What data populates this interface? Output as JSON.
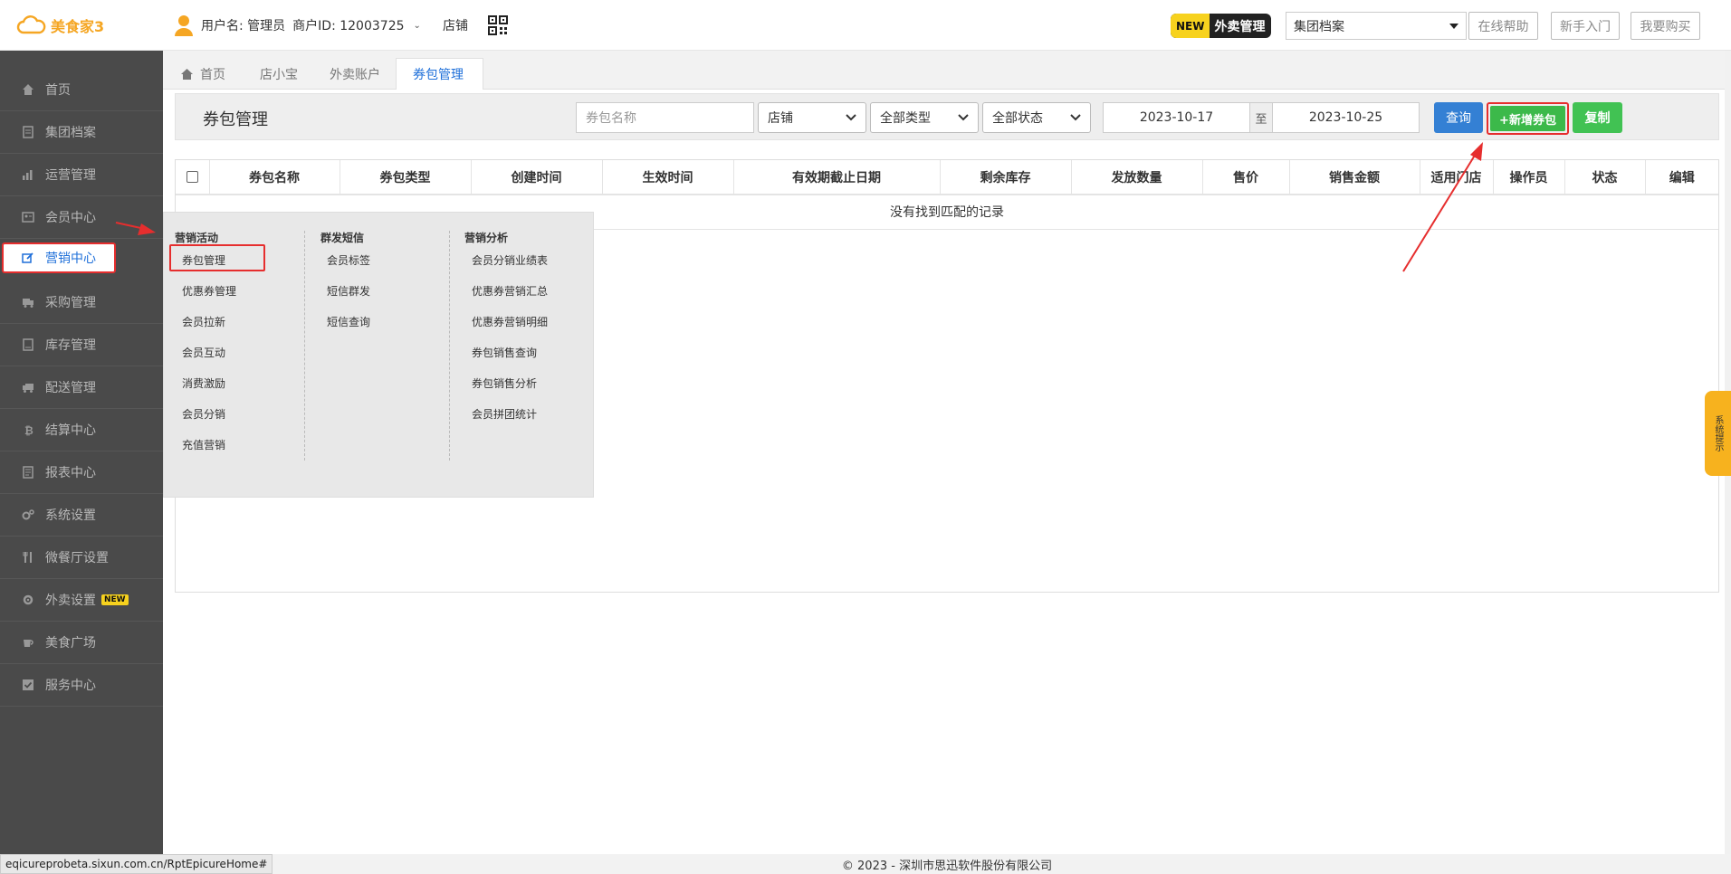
{
  "header": {
    "logo_text": "美食家3",
    "user_label": "用户名: 管理员",
    "merchant_label": "商户ID: 12003725",
    "store_link": "店铺",
    "new_badge_tag": "NEW",
    "new_badge_text": "外卖管理",
    "archive_select": "集团档案",
    "help_button": "在线帮助",
    "guide_button": "新手入门",
    "buy_button": "我要购买"
  },
  "sidebar": {
    "items": [
      {
        "label": "首页",
        "icon": "home-icon"
      },
      {
        "label": "集团档案",
        "icon": "document-icon"
      },
      {
        "label": "运营管理",
        "icon": "bar-chart-icon"
      },
      {
        "label": "会员中心",
        "icon": "member-card-icon"
      },
      {
        "label": "营销中心",
        "icon": "edit-icon",
        "active": true
      },
      {
        "label": "采购管理",
        "icon": "truck-icon"
      },
      {
        "label": "库存管理",
        "icon": "file-icon"
      },
      {
        "label": "配送管理",
        "icon": "delivery-truck-icon"
      },
      {
        "label": "结算中心",
        "icon": "bitcoin-icon"
      },
      {
        "label": "报表中心",
        "icon": "report-icon"
      },
      {
        "label": "系统设置",
        "icon": "gears-icon"
      },
      {
        "label": "微餐厅设置",
        "icon": "cutlery-icon"
      },
      {
        "label": "外卖设置",
        "icon": "gear-icon",
        "badge": "NEW"
      },
      {
        "label": "美食广场",
        "icon": "coffee-icon"
      },
      {
        "label": "服务中心",
        "icon": "check-square-icon"
      }
    ]
  },
  "tabs": [
    {
      "label": "首页"
    },
    {
      "label": "店小宝"
    },
    {
      "label": "外卖账户"
    },
    {
      "label": "券包管理",
      "active": true
    }
  ],
  "toolbar": {
    "title": "券包管理",
    "name_placeholder": "券包名称",
    "store_select": "店铺",
    "type_select": "全部类型",
    "status_select": "全部状态",
    "date_start": "2023-10-17",
    "date_sep": "至",
    "date_end": "2023-10-25",
    "query_button": "查询",
    "add_button": "+新增券包",
    "copy_button": "复制"
  },
  "table": {
    "columns": [
      "券包名称",
      "券包类型",
      "创建时间",
      "生效时间",
      "有效期截止日期",
      "剩余库存",
      "发放数量",
      "售价",
      "销售金额",
      "适用门店",
      "操作员",
      "状态",
      "编辑"
    ],
    "empty_text": "没有找到匹配的记录"
  },
  "mega_menu": {
    "col1": {
      "title": "营销活动",
      "items": [
        "券包管理",
        "优惠券管理",
        "会员拉新",
        "会员互动",
        "消费激励",
        "会员分销",
        "充值营销"
      ]
    },
    "col2": {
      "title": "群发短信",
      "items": [
        "会员标签",
        "短信群发",
        "短信查询"
      ]
    },
    "col3": {
      "title": "营销分析",
      "items": [
        "会员分销业绩表",
        "优惠券营销汇总",
        "优惠券营销明细",
        "券包销售查询",
        "券包销售分析",
        "会员拼团统计"
      ]
    }
  },
  "side_tab": "系统提示",
  "footer": "© 2023 - 深圳市思迅软件股份有限公司",
  "status_url": "eqicureprobeta.sixun.com.cn/RptEpicureHome#",
  "colors": {
    "accent": "#1e6fd9",
    "sidebar_bg": "#4a4a4a",
    "highlight_red": "#e62e2e",
    "add_green": "#3cb94a",
    "query_blue": "#3480d4",
    "logo_orange": "#f5a623"
  }
}
